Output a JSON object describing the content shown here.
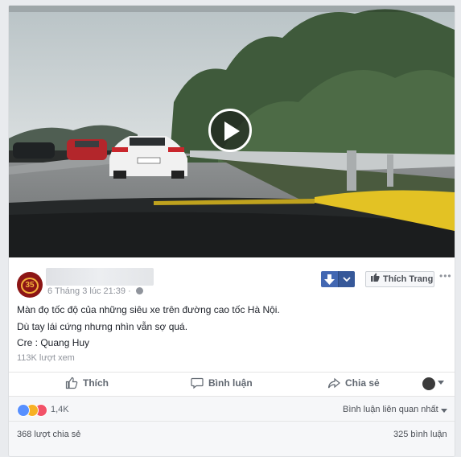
{
  "post": {
    "date": "6 Tháng 3 lúc 21:39",
    "separator": "·",
    "line1": "Màn đọ tốc độ của những siêu xe trên đường cao tốc Hà Nội.",
    "line2": "Dù tay lái cứng nhưng nhìn vẫn sợ quá.",
    "line3": "Cre : Quang Huy",
    "views": "113K lượt xem"
  },
  "header": {
    "like_page_label": "Thích Trang",
    "more_label": "•••"
  },
  "actions": {
    "like_label": "Thích",
    "comment_label": "Bình luận",
    "share_label": "Chia sẻ"
  },
  "reactions": {
    "count": "1,4K",
    "sort_label": "Bình luận liên quan nhất",
    "icons": [
      "like-icon",
      "wow-icon",
      "love-icon"
    ]
  },
  "stats": {
    "shares": "368 lượt chia sẻ",
    "comments": "325 bình luận"
  },
  "colors": {
    "accent": "#4267b2",
    "text_muted": "#90949c",
    "reaction_like": "#5890ff",
    "reaction_wow": "#f7b125",
    "reaction_love": "#f25268"
  }
}
